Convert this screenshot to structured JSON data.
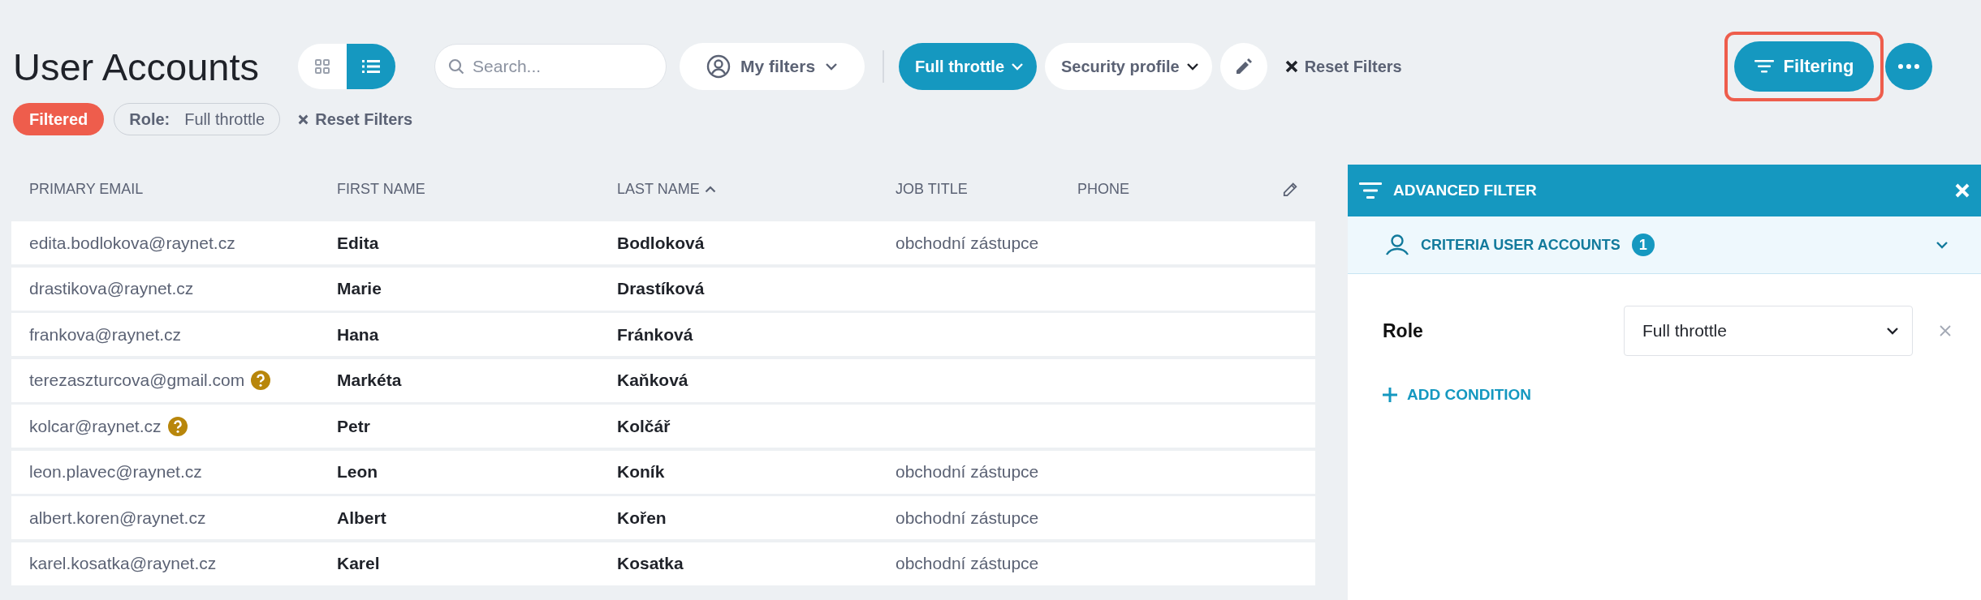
{
  "title": "User Accounts",
  "view_toggle": [
    {
      "kind": "grid",
      "selected": false
    },
    {
      "kind": "list",
      "selected": true
    }
  ],
  "search": {
    "placeholder": "Search..."
  },
  "my_filters": {
    "label": "My filters"
  },
  "filter_chips": [
    {
      "label": "Full throttle",
      "selected": true
    },
    {
      "label": "Security profile",
      "selected": false
    }
  ],
  "reset_filters": "Reset Filters",
  "filtering_button": {
    "label": "Filtering",
    "highlighted": true
  },
  "applied": {
    "badge": "Filtered",
    "filter_label": "Role:",
    "filter_value": "Full throttle",
    "reset": "Reset Filters"
  },
  "table": {
    "columns": [
      {
        "label": "PRIMARY EMAIL",
        "sorted": false
      },
      {
        "label": "FIRST NAME",
        "sorted": false
      },
      {
        "label": "LAST NAME",
        "sorted": true
      },
      {
        "label": "JOB TITLE",
        "sorted": false
      },
      {
        "label": "PHONE",
        "sorted": false
      }
    ],
    "rows": [
      {
        "email": "edita.bodlokova@raynet.cz",
        "warning": false,
        "first_name": "Edita",
        "last_name": "Bodloková",
        "job_title": "obchodní zástupce"
      },
      {
        "email": "drastikova@raynet.cz",
        "warning": false,
        "first_name": "Marie",
        "last_name": "Drastíková"
      },
      {
        "email": "frankova@raynet.cz",
        "warning": false,
        "first_name": "Hana",
        "last_name": "Fránková"
      },
      {
        "email": "terezaszturcova@gmail.com",
        "warning": true,
        "first_name": "Markéta",
        "last_name": "Kaňková"
      },
      {
        "email": "kolcar@raynet.cz",
        "warning": true,
        "first_name": "Petr",
        "last_name": "Kolčář"
      },
      {
        "email": "leon.plavec@raynet.cz",
        "warning": false,
        "first_name": "Leon",
        "last_name": "Koník",
        "job_title": "obchodní zástupce"
      },
      {
        "email": "albert.koren@raynet.cz",
        "warning": false,
        "first_name": "Albert",
        "last_name": "Kořen",
        "job_title": "obchodní zástupce"
      },
      {
        "email": "karel.kosatka@raynet.cz",
        "warning": false,
        "first_name": "Karel",
        "last_name": "Kosatka",
        "job_title": "obchodní zástupce"
      }
    ]
  },
  "advanced_filter": {
    "title": "ADVANCED FILTER",
    "criteria": {
      "label": "CRITERIA USER ACCOUNTS",
      "count": "1"
    },
    "conditions": [
      {
        "field": "Role",
        "value": "Full throttle"
      }
    ],
    "add_condition": "ADD CONDITION"
  }
}
